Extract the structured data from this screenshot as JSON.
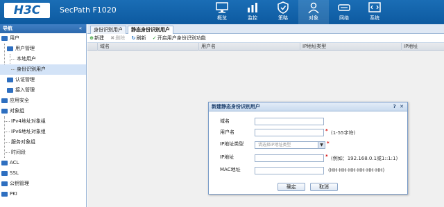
{
  "header": {
    "logo": "H3C",
    "product": "SecPath F1020",
    "nav": [
      {
        "label": "概览",
        "icon": "monitor-icon"
      },
      {
        "label": "监控",
        "icon": "chart-icon"
      },
      {
        "label": "策略",
        "icon": "shield-icon"
      },
      {
        "label": "对象",
        "icon": "object-icon"
      },
      {
        "label": "网络",
        "icon": "network-icon"
      },
      {
        "label": "系统",
        "icon": "system-icon"
      }
    ],
    "active_index": 3
  },
  "sidebar": {
    "title": "导航",
    "collapse": "«",
    "items": [
      {
        "label": "用户"
      },
      {
        "label": "用户管理"
      },
      {
        "label": "本地用户"
      },
      {
        "label": "身份识别用户"
      },
      {
        "label": "认证管理"
      },
      {
        "label": "接入管理"
      },
      {
        "label": "应用安全"
      },
      {
        "label": "对象组"
      },
      {
        "label": "IPv4地址对象组"
      },
      {
        "label": "IPv6地址对象组"
      },
      {
        "label": "服务对象组"
      },
      {
        "label": "时间段"
      },
      {
        "label": "ACL"
      },
      {
        "label": "SSL"
      },
      {
        "label": "公钥管理"
      },
      {
        "label": "PKI"
      }
    ]
  },
  "tabs": [
    {
      "label": "身份识别用户"
    },
    {
      "label": "静态身份识别用户"
    }
  ],
  "toolbar": {
    "new": "新建",
    "delete": "删除",
    "refresh": "刷新",
    "enable": "开启用户身份识别功能"
  },
  "grid": {
    "columns": [
      "域名",
      "用户名",
      "IP地址类型",
      "IP地址"
    ]
  },
  "dialog": {
    "title": "新建静态身份识别用户",
    "help": "?",
    "close": "✕",
    "fields": {
      "domain_label": "域名",
      "username_label": "用户名",
      "username_hint": "(1-55字符)",
      "iptype_label": "IP地址类型",
      "iptype_placeholder": "请选择IP地址类型",
      "ip_label": "IP地址",
      "ip_hint": "(例如：192.168.0.1或1::1:1)",
      "mac_label": "MAC地址",
      "mac_hint": "(HH-HH-HH-HH-HH-HH)"
    },
    "ok": "确定",
    "cancel": "取消"
  },
  "colors": {
    "header_blue": "#1565b0",
    "required_red": "#d40000"
  }
}
